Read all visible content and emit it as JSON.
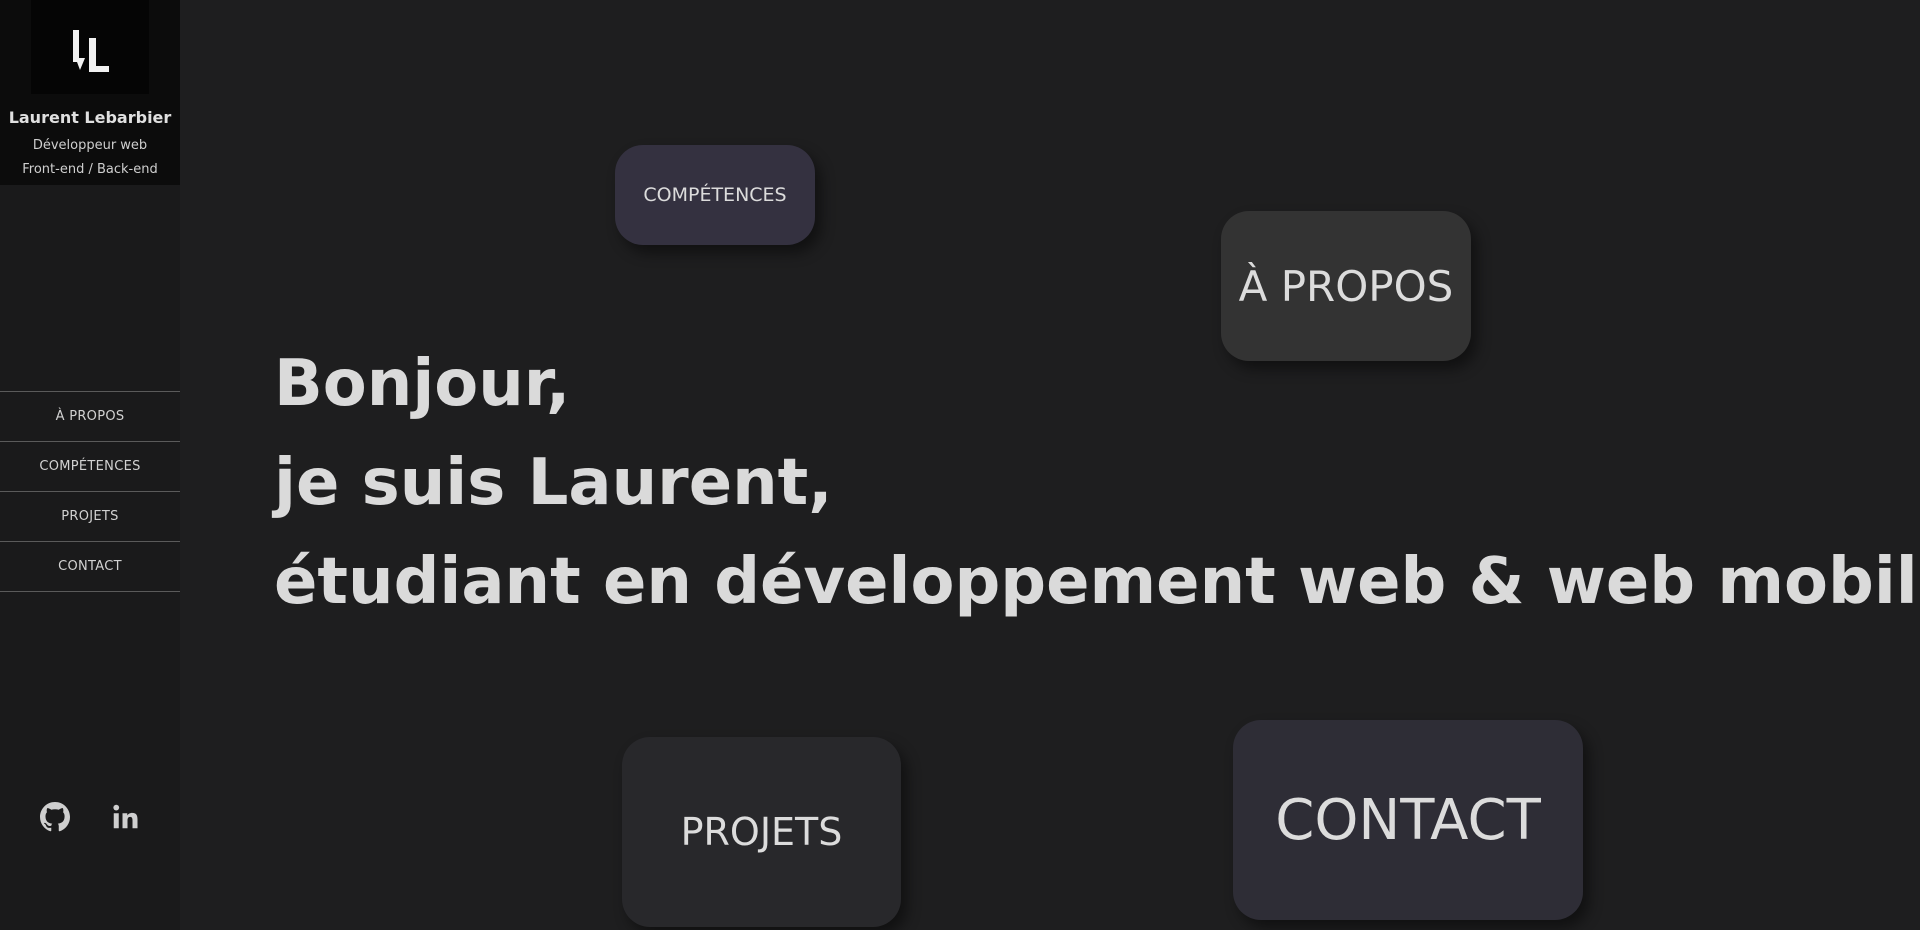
{
  "profile": {
    "name": "Laurent Lebarbier",
    "role": "Développeur web",
    "stack": "Front-end / Back-end",
    "logo_icon": "ll-monogram-logo"
  },
  "nav": {
    "items": [
      {
        "label": "À PROPOS"
      },
      {
        "label": "COMPÉTENCES"
      },
      {
        "label": "PROJETS"
      },
      {
        "label": "CONTACT"
      }
    ]
  },
  "social": {
    "github_icon": "github-icon",
    "linkedin_icon": "linkedin-icon"
  },
  "hero": {
    "line1": "Bonjour,",
    "line2": "je suis Laurent,",
    "line3": "étudiant en développement web & web mobile"
  },
  "tiles": {
    "competences": "COMPÉTENCES",
    "apropos": "À PROPOS",
    "projets": "PROJETS",
    "contact": "CONTACT"
  },
  "colors": {
    "background": "#1e1e1f",
    "sidebar": "#1a1a1b",
    "sidebar_header": "#0c0c0c",
    "tile_competences": "#343140",
    "tile_apropos": "#333333",
    "tile_projets": "#28282b",
    "tile_contact": "#2e2d36",
    "text": "#dadada"
  }
}
